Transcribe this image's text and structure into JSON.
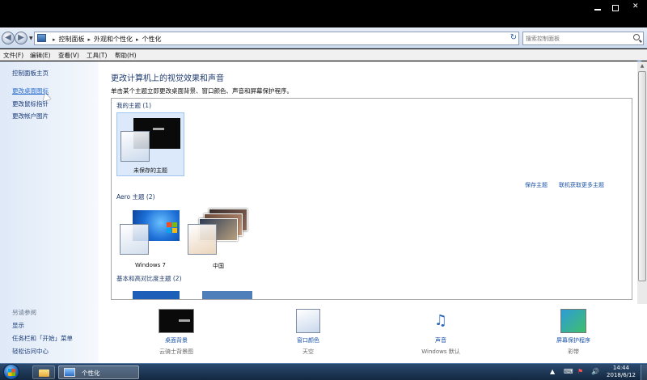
{
  "breadcrumb": [
    "控制面板",
    "外观和个性化",
    "个性化"
  ],
  "search": {
    "placeholder": "搜索控制面板"
  },
  "menu": [
    "文件(F)",
    "编辑(E)",
    "查看(V)",
    "工具(T)",
    "帮助(H)"
  ],
  "sidebar": {
    "links": [
      "控制面板主页",
      "更改桌面图标",
      "更改鼠标指针",
      "更改帐户图片"
    ],
    "see_also_title": "另请参阅",
    "see_also": [
      "显示",
      "任务栏和「开始」菜单",
      "轻松访问中心"
    ]
  },
  "main": {
    "title": "更改计算机上的视觉效果和声音",
    "subtitle": "单击某个主题立即更改桌面背景、窗口颜色、声音和屏幕保护程序。",
    "groups": {
      "my": "我的主题 (1)",
      "aero": "Aero 主题 (2)",
      "basic": "基本和高对比度主题 (2)"
    },
    "themes": {
      "unsaved": "未保存的主题",
      "win7": "Windows 7",
      "china": "中国"
    },
    "links": {
      "save": "保存主题",
      "online": "联机获取更多主题"
    }
  },
  "bottom": [
    {
      "label": "桌面背景",
      "sub": "云骑士背景图"
    },
    {
      "label": "窗口颜色",
      "sub": "天空"
    },
    {
      "label": "声音",
      "sub": "Windows 默认"
    },
    {
      "label": "屏幕保护程序",
      "sub": "彩带"
    }
  ],
  "taskbar": {
    "window_label": "个性化",
    "time": "14:44",
    "date": "2018/6/12"
  },
  "colors": {
    "link": "#1a53a8",
    "title": "#1e3a6d",
    "selection": "#dbe9fb"
  },
  "icons": [
    "nav-back-icon",
    "nav-forward-icon",
    "control-panel-icon",
    "refresh-icon",
    "search-icon",
    "help-icon",
    "wallpaper-icon",
    "window-color-icon",
    "sound-icon",
    "screensaver-icon",
    "start-orb-icon",
    "folder-icon"
  ]
}
